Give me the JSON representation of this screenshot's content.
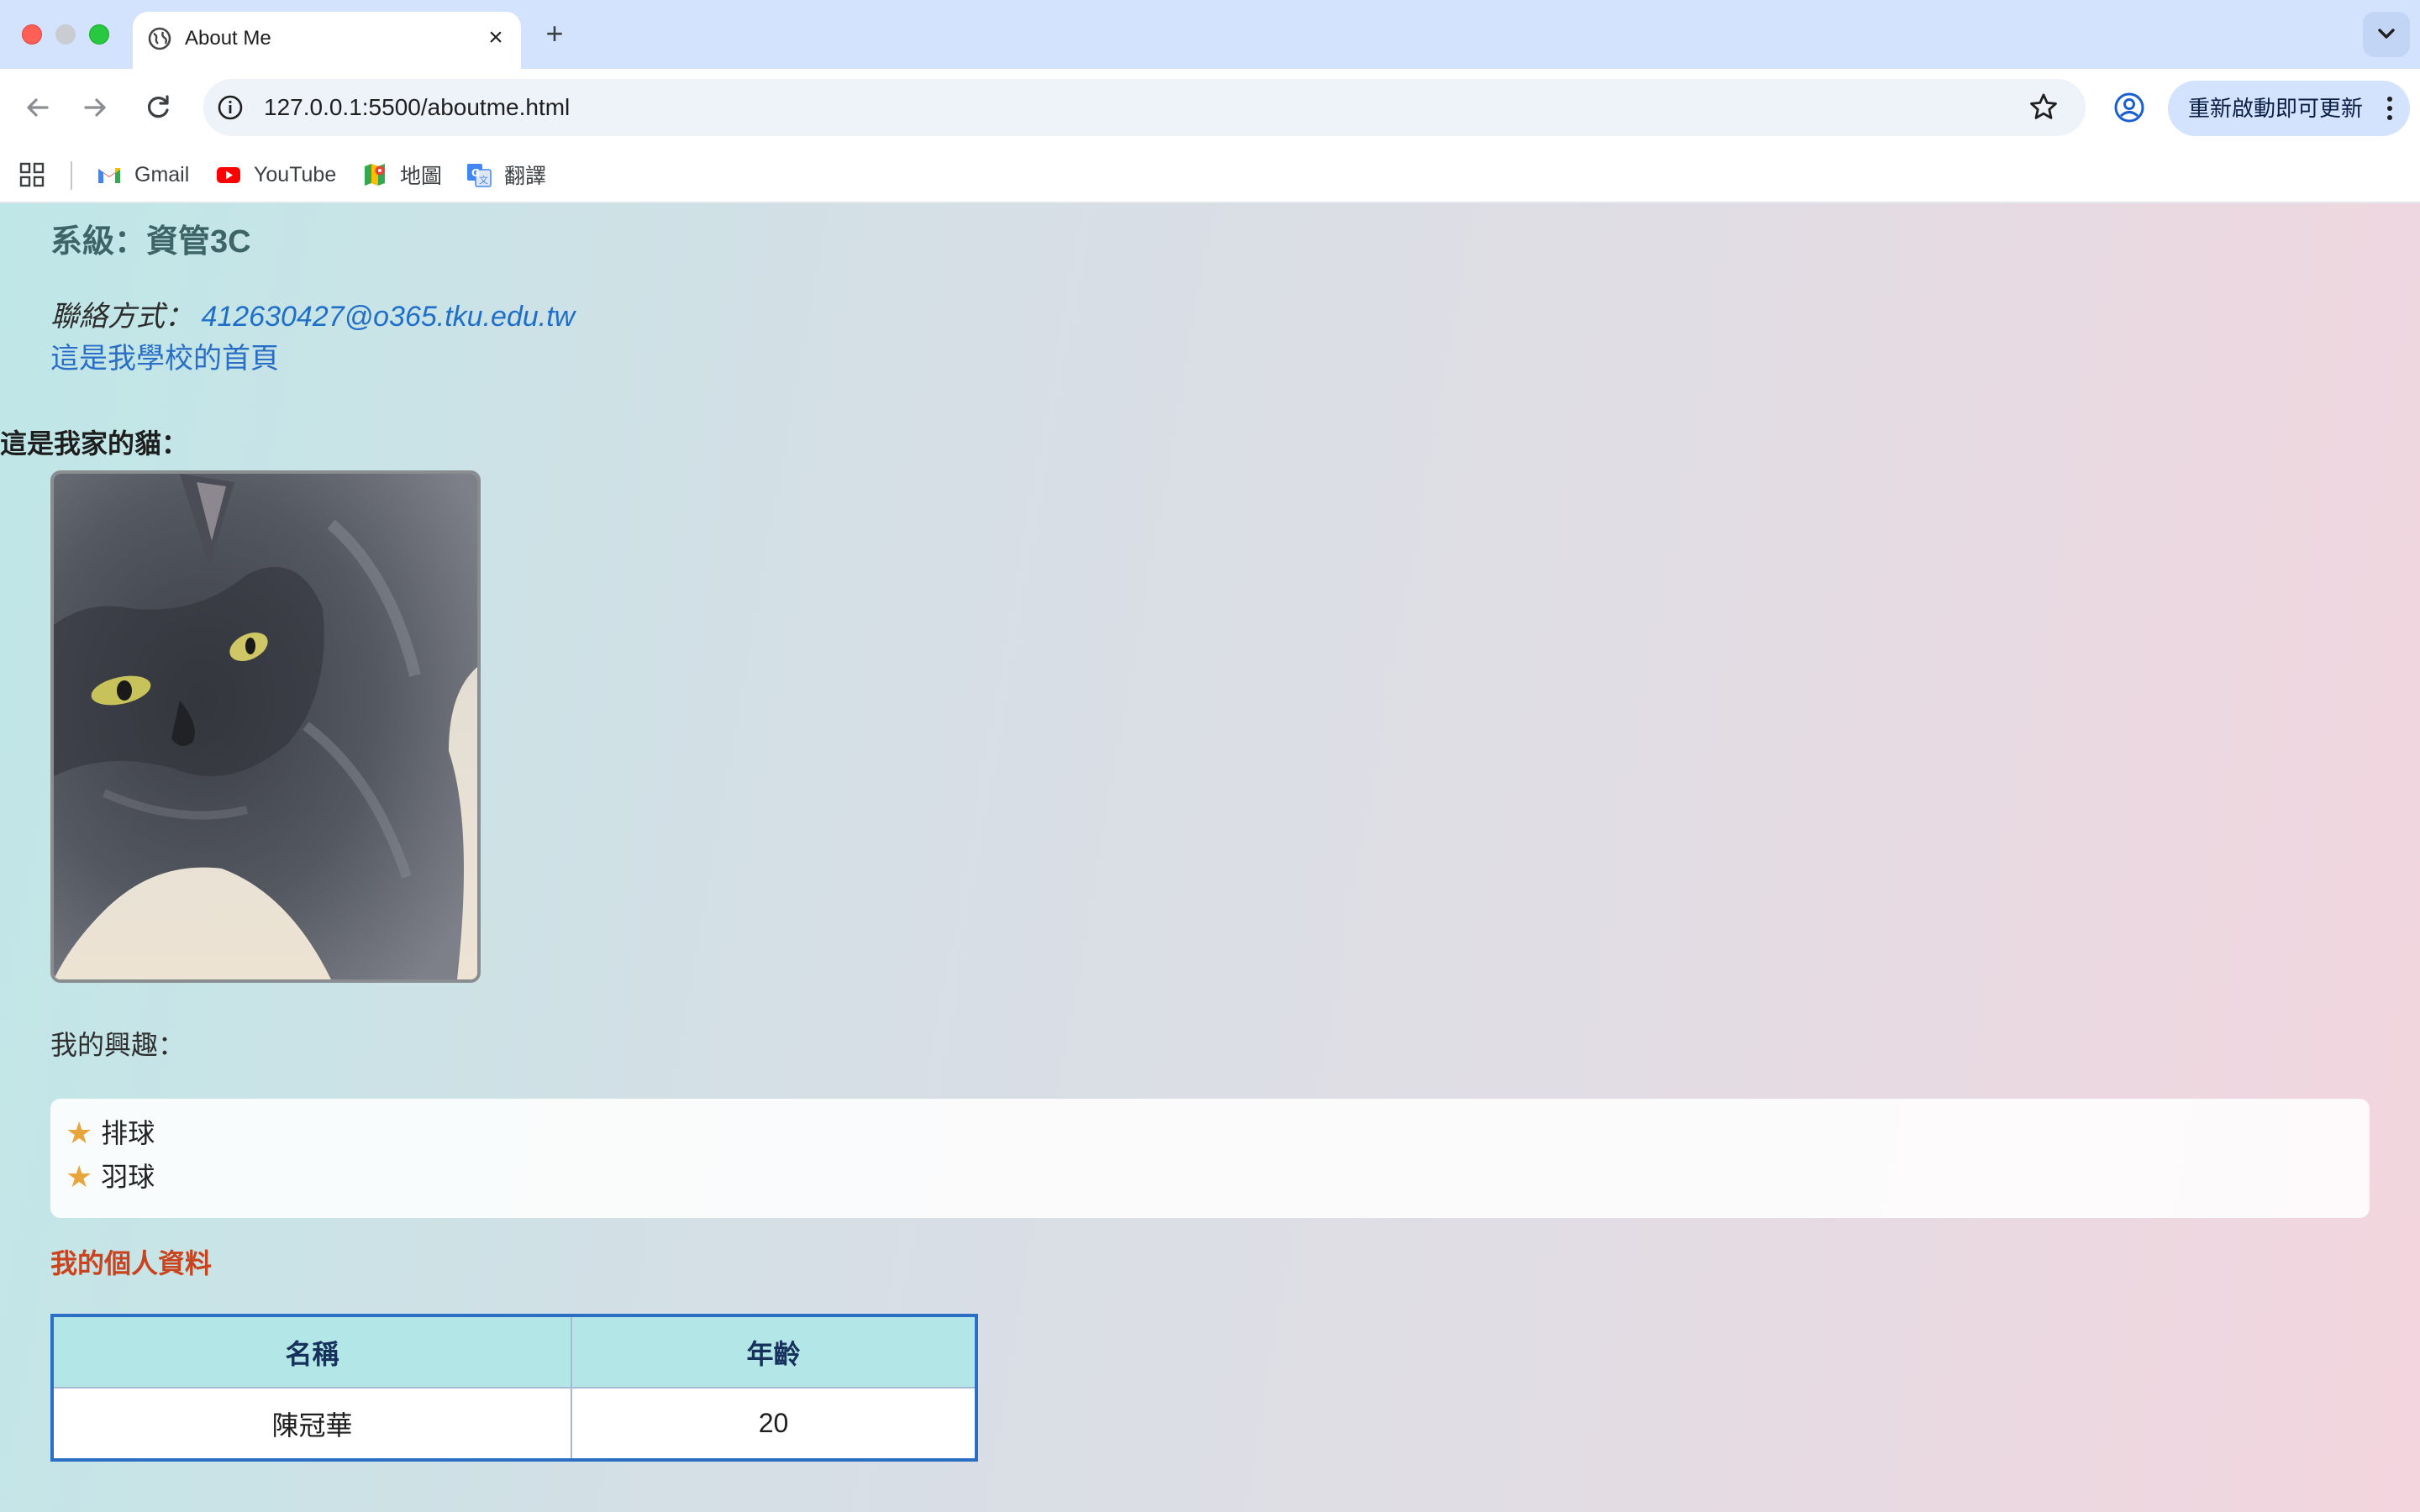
{
  "browser": {
    "tab_title": "About Me",
    "tab_close": "×",
    "new_tab": "+",
    "url_host": "127.0.0.1",
    "url_path": ":5500/aboutme.html",
    "update_label": "重新啟動即可更新",
    "bookmarks": [
      {
        "label": "Gmail",
        "icon": "gmail-icon"
      },
      {
        "label": "YouTube",
        "icon": "youtube-icon"
      },
      {
        "label": "地圖",
        "icon": "maps-icon"
      },
      {
        "label": "翻譯",
        "icon": "translate-icon"
      }
    ]
  },
  "page": {
    "department": "系級：資管3C",
    "contact_label": "聯絡方式：",
    "contact_email": "412630427@o365.tku.edu.tw",
    "school_link": "這是我學校的首頁",
    "cat_title": "這是我家的貓：",
    "interests_title": "我的興趣：",
    "interests": [
      "排球",
      "羽球"
    ],
    "profile_title": "我的個人資料",
    "table": {
      "headers": [
        "名稱",
        "年齡"
      ],
      "rows": [
        [
          "陳冠華",
          "20"
        ]
      ]
    }
  },
  "colors": {
    "tab_bar": "#d3e3fd",
    "link": "#2a6fc5",
    "profile_title": "#c9441e",
    "table_header_bg": "#b3e6e7",
    "table_border": "#2b6fc5",
    "star": "#e7a53c"
  }
}
